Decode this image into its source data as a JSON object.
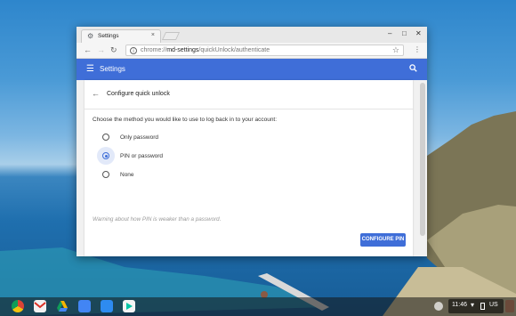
{
  "window": {
    "tab_title": "Settings",
    "tab_close": "×",
    "controls": {
      "minimize": "–",
      "maximize": "□",
      "close": "✕"
    }
  },
  "toolbar": {
    "url_scheme": "chrome://",
    "url_host": "md-settings",
    "url_path": "/quickUnlock/authenticate"
  },
  "appbar": {
    "title": "Settings"
  },
  "page": {
    "title": "Configure quick unlock",
    "instruction": "Choose the method you would like to use to log back in to your account:",
    "options": [
      {
        "label": "Only password",
        "selected": false
      },
      {
        "label": "PIN or password",
        "selected": true
      },
      {
        "label": "None",
        "selected": false
      }
    ],
    "warning": "Warning about how PIN is weaker than a password.",
    "configure_button": "CONFIGURE PIN"
  },
  "shelf": {
    "apps": [
      {
        "name": "chrome-app-icon",
        "color": "#e53935"
      },
      {
        "name": "gmail-app-icon",
        "color": "#f2f2f2"
      },
      {
        "name": "drive-app-icon",
        "color": "#1fa463"
      },
      {
        "name": "calendar-app-icon",
        "color": "#4285f4"
      },
      {
        "name": "files-app-icon",
        "color": "#2e8bf0"
      },
      {
        "name": "play-store-app-icon",
        "color": "#00c4a6"
      }
    ],
    "time": "11:46",
    "ime": "US"
  },
  "colors": {
    "accent": "#3f6ed8"
  }
}
